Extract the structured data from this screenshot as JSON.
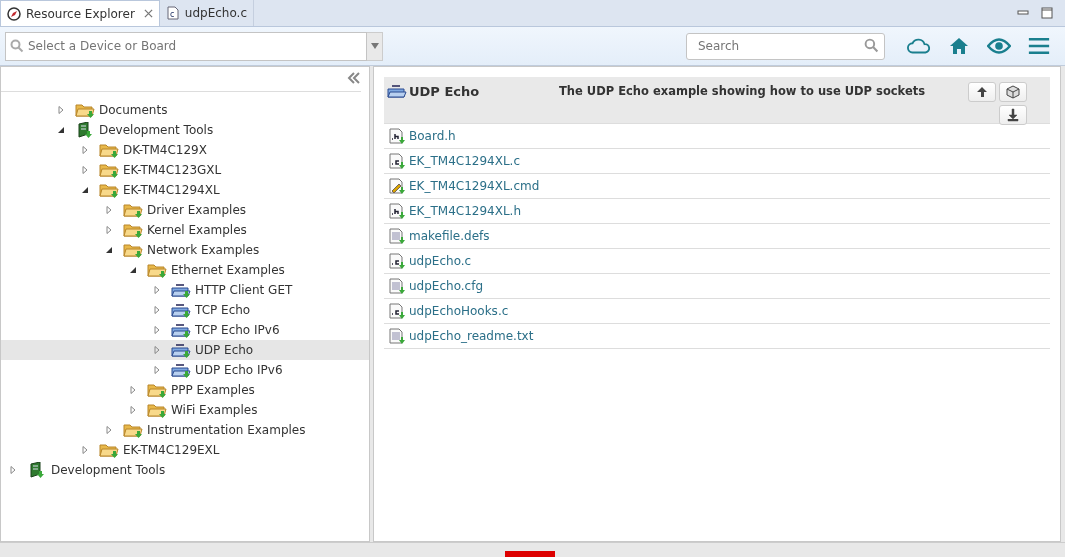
{
  "tabs": [
    {
      "label": "Resource Explorer",
      "kind": "explorer",
      "selected": true,
      "closable": true
    },
    {
      "label": "udpEcho.c",
      "kind": "cfile",
      "selected": false,
      "closable": false
    }
  ],
  "device_select": {
    "placeholder": "Select a Device or Board"
  },
  "search": {
    "placeholder": "Search"
  },
  "tree": [
    {
      "label": "Documents",
      "kind": "folder",
      "expanded": false,
      "selected": false
    },
    {
      "label": "Development Tools",
      "kind": "tools",
      "expanded": true,
      "selected": false,
      "children": [
        {
          "label": "DK-TM4C129X",
          "kind": "folder",
          "expanded": false,
          "selected": false
        },
        {
          "label": "EK-TM4C123GXL",
          "kind": "folder",
          "expanded": false,
          "selected": false
        },
        {
          "label": "EK-TM4C1294XL",
          "kind": "folder",
          "expanded": true,
          "selected": false,
          "children": [
            {
              "label": "Driver Examples",
              "kind": "folder",
              "expanded": false,
              "selected": false
            },
            {
              "label": "Kernel Examples",
              "kind": "folder",
              "expanded": false,
              "selected": false
            },
            {
              "label": "Network Examples",
              "kind": "folder",
              "expanded": true,
              "selected": false,
              "children": [
                {
                  "label": "Ethernet Examples",
                  "kind": "folder",
                  "expanded": true,
                  "selected": false,
                  "children": [
                    {
                      "label": "HTTP Client GET",
                      "kind": "project",
                      "expanded": false,
                      "selected": false
                    },
                    {
                      "label": "TCP Echo",
                      "kind": "project",
                      "expanded": false,
                      "selected": false
                    },
                    {
                      "label": "TCP Echo IPv6",
                      "kind": "project",
                      "expanded": false,
                      "selected": false
                    },
                    {
                      "label": "UDP Echo",
                      "kind": "project",
                      "expanded": false,
                      "selected": true
                    },
                    {
                      "label": "UDP Echo IPv6",
                      "kind": "project",
                      "expanded": false,
                      "selected": false
                    }
                  ]
                },
                {
                  "label": "PPP Examples",
                  "kind": "folder",
                  "expanded": false,
                  "selected": false
                },
                {
                  "label": "WiFi Examples",
                  "kind": "folder",
                  "expanded": false,
                  "selected": false
                }
              ]
            },
            {
              "label": "Instrumentation Examples",
              "kind": "folder",
              "expanded": false,
              "selected": false
            }
          ]
        },
        {
          "label": "EK-TM4C129EXL",
          "kind": "folder",
          "expanded": false,
          "selected": false
        }
      ]
    }
  ],
  "tree_footer": [
    {
      "label": "Development Tools",
      "kind": "tools",
      "expanded": false,
      "selected": false
    }
  ],
  "detail": {
    "title": "UDP Echo",
    "description": "The UDP Echo example showing how to use UDP sockets",
    "files": [
      {
        "name": "Board.h",
        "kind": "h"
      },
      {
        "name": "EK_TM4C1294XL.c",
        "kind": "c"
      },
      {
        "name": "EK_TM4C1294XL.cmd",
        "kind": "cmd"
      },
      {
        "name": "EK_TM4C1294XL.h",
        "kind": "h"
      },
      {
        "name": "makefile.defs",
        "kind": "txt"
      },
      {
        "name": "udpEcho.c",
        "kind": "c"
      },
      {
        "name": "udpEcho.cfg",
        "kind": "txt"
      },
      {
        "name": "udpEchoHooks.c",
        "kind": "c"
      },
      {
        "name": "udpEcho_readme.txt",
        "kind": "txt"
      }
    ]
  }
}
